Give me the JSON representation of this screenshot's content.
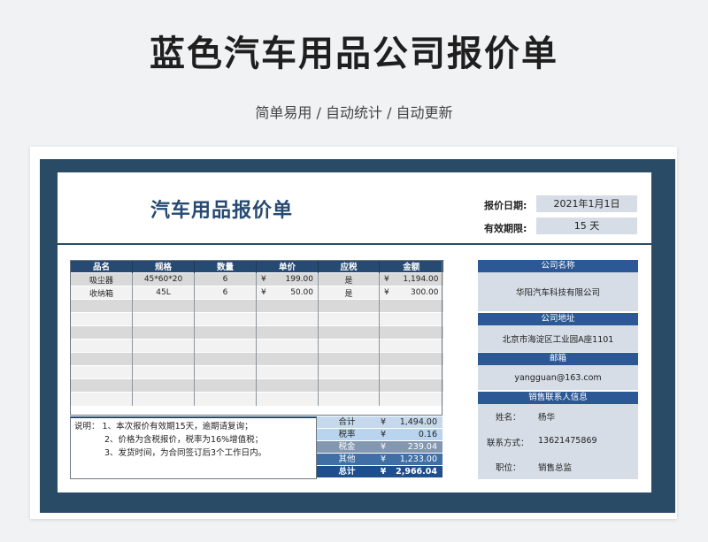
{
  "page": {
    "title": "蓝色汽车用品公司报价单",
    "subtitle": "简单易用 / 自动统计 / 自动更新"
  },
  "doc": {
    "title": "汽车用品报价单",
    "quote_date_label": "报价日期:",
    "quote_date": "2021年1月1日",
    "valid_label": "有效期限:",
    "valid": "15 天"
  },
  "items": {
    "headers": [
      "品名",
      "规格",
      "数量",
      "单价",
      "应税",
      "金额"
    ],
    "currency": "¥",
    "rows": [
      {
        "name": "吸尘器",
        "spec": "45*60*20",
        "qty": "6",
        "price": "199.00",
        "tax": "是",
        "amount": "1,194.00"
      },
      {
        "name": "收纳箱",
        "spec": "45L",
        "qty": "6",
        "price": "50.00",
        "tax": "是",
        "amount": "300.00"
      }
    ]
  },
  "notes": {
    "prefix": "说明：",
    "line1": "1、本次报价有效期15天，逾期请复询；",
    "line2": "2、价格为含税报价，税率为16%增值税；",
    "line3": "3、发货时间，为合同签订后3个工作日内。"
  },
  "totals": {
    "currency": "¥",
    "rows": [
      {
        "label": "合计",
        "value": "1,494.00"
      },
      {
        "label": "税率",
        "value": "0.16"
      },
      {
        "label": "税金",
        "value": "239.04"
      },
      {
        "label": "其他",
        "value": "1,233.00"
      },
      {
        "label": "总计",
        "value": "2,966.04"
      }
    ]
  },
  "company": {
    "name_header": "公司名称",
    "name": "华阳汽车科技有限公司",
    "address_header": "公司地址",
    "address": "北京市海淀区工业园A座1101",
    "email_header": "邮箱",
    "email": "yangguan@163.com",
    "contact_header": "销售联系人信息",
    "contact_name_label": "姓名：",
    "contact_name": "杨华",
    "contact_phone_label": "联系方式：",
    "contact_phone": "13621475869",
    "contact_title_label": "职位：",
    "contact_title": "销售总监"
  }
}
